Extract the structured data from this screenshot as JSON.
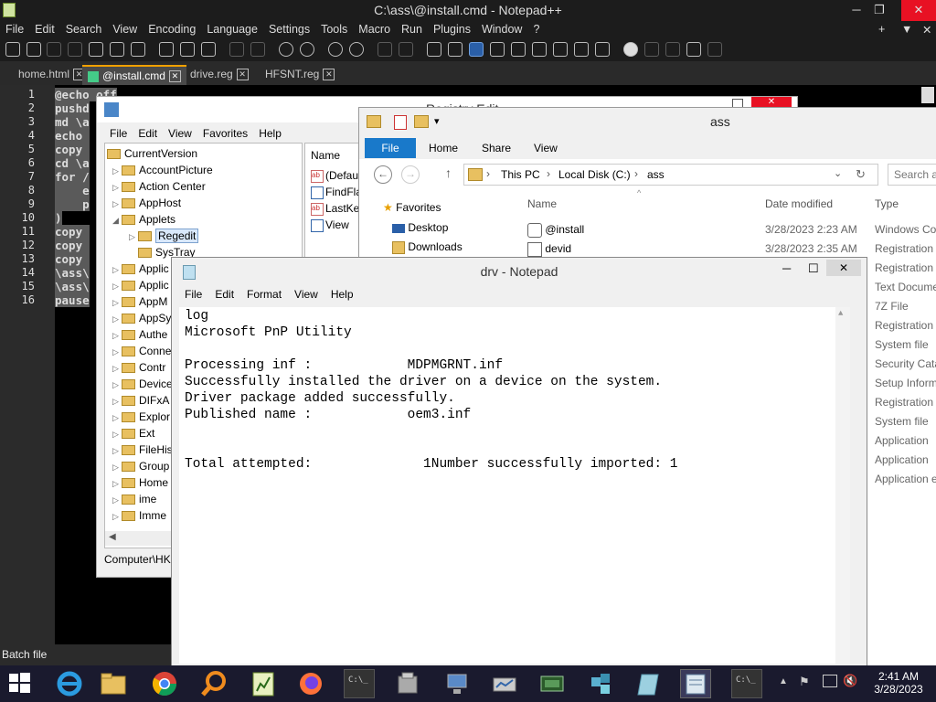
{
  "npp": {
    "title": "C:\\ass\\@install.cmd - Notepad++",
    "menu": [
      "File",
      "Edit",
      "Search",
      "View",
      "Encoding",
      "Language",
      "Settings",
      "Tools",
      "Macro",
      "Run",
      "Plugins",
      "Window",
      "?"
    ],
    "right_controls": [
      "+",
      "▼",
      "✕"
    ],
    "tabs": [
      {
        "label": "home.html",
        "active": false
      },
      {
        "label": "@install.cmd",
        "active": true
      },
      {
        "label": "drive.reg",
        "active": false
      },
      {
        "label": "HFSNT.reg",
        "active": false
      }
    ],
    "line_numbers": [
      "1",
      "2",
      "3",
      "4",
      "5",
      "6",
      "7",
      "8",
      "9",
      "10",
      "11",
      "12",
      "13",
      "14",
      "15",
      "16"
    ],
    "code_lines": [
      "@echo off",
      "pushd",
      "md \\a",
      "echo ",
      "copy ",
      "cd \\a",
      "for /",
      "    e",
      "    p",
      ")",
      "copy ",
      "copy ",
      "copy ",
      "\\ass\\",
      "\\ass\\",
      "pause"
    ],
    "status": "Batch file"
  },
  "regedit": {
    "title": "Registry Edit",
    "menu": [
      "File",
      "Edit",
      "View",
      "Favorites",
      "Help"
    ],
    "tree": [
      {
        "label": "CurrentVersion",
        "indent": 0,
        "expanded": true
      },
      {
        "label": "AccountPicture",
        "indent": 1
      },
      {
        "label": "Action Center",
        "indent": 1
      },
      {
        "label": "AppHost",
        "indent": 1
      },
      {
        "label": "Applets",
        "indent": 1,
        "expanded": true
      },
      {
        "label": "Regedit",
        "indent": 2,
        "selected": true
      },
      {
        "label": "SysTray",
        "indent": 2
      },
      {
        "label": "Applic",
        "indent": 1
      },
      {
        "label": "Applic",
        "indent": 1
      },
      {
        "label": "AppM",
        "indent": 1
      },
      {
        "label": "AppSy",
        "indent": 1
      },
      {
        "label": "Authe",
        "indent": 1
      },
      {
        "label": "Conne",
        "indent": 1
      },
      {
        "label": "Contr",
        "indent": 1
      },
      {
        "label": "Device",
        "indent": 1
      },
      {
        "label": "DIFxA",
        "indent": 1
      },
      {
        "label": "Explor",
        "indent": 1
      },
      {
        "label": "Ext",
        "indent": 1
      },
      {
        "label": "FileHis",
        "indent": 1
      },
      {
        "label": "Group",
        "indent": 1
      },
      {
        "label": "Home",
        "indent": 1
      },
      {
        "label": "ime",
        "indent": 1
      },
      {
        "label": "Imme",
        "indent": 1
      }
    ],
    "values_header": "Name",
    "values": [
      "(Defau",
      "FindFla",
      "LastKe",
      "View"
    ],
    "status": "Computer\\HK"
  },
  "explorer": {
    "title": "ass",
    "ribbon_tabs": [
      "File",
      "Home",
      "Share",
      "View"
    ],
    "breadcrumb": [
      "This PC",
      "Local Disk (C:)",
      "ass"
    ],
    "search_placeholder": "Search as",
    "nav": [
      {
        "label": "Favorites"
      },
      {
        "label": "Desktop"
      },
      {
        "label": "Downloads"
      }
    ],
    "columns": [
      "Name",
      "Date modified",
      "Type"
    ],
    "files": [
      {
        "name": "@install",
        "date": "3/28/2023 2:23 AM",
        "type": "Windows Co"
      },
      {
        "name": "devid",
        "date": "3/28/2023 2:35 AM",
        "type": "Registration"
      }
    ],
    "more_types": [
      "Registration",
      "Text Docume",
      "7Z File",
      "Registration",
      "System file",
      "Security Cata",
      "Setup Inform",
      "Registration",
      "System file",
      "Application",
      "Application",
      "Application e"
    ]
  },
  "notepad": {
    "title": "drv - Notepad",
    "menu": [
      "File",
      "Edit",
      "Format",
      "View",
      "Help"
    ],
    "lines": [
      "log",
      "Microsoft PnP Utility",
      "",
      "Processing inf :            MDPMGRNT.inf",
      "Successfully installed the driver on a device on the system.",
      "Driver package added successfully.",
      "Published name :            oem3.inf",
      "",
      "",
      "Total attempted:              1Number successfully imported: 1"
    ]
  },
  "taskbar": {
    "time": "2:41 AM",
    "date": "3/28/2023",
    "icons": [
      "start-icon",
      "ie-icon",
      "file-explorer-icon",
      "chrome-icon",
      "search-tool-icon",
      "spreadsheet-icon",
      "firefox-icon",
      "cmd-icon",
      "tool-icon",
      "computer-icon",
      "network-icon",
      "hardware-icon",
      "package-icon",
      "notebook-icon",
      "notepad-icon",
      "cmd-icon-2"
    ]
  }
}
